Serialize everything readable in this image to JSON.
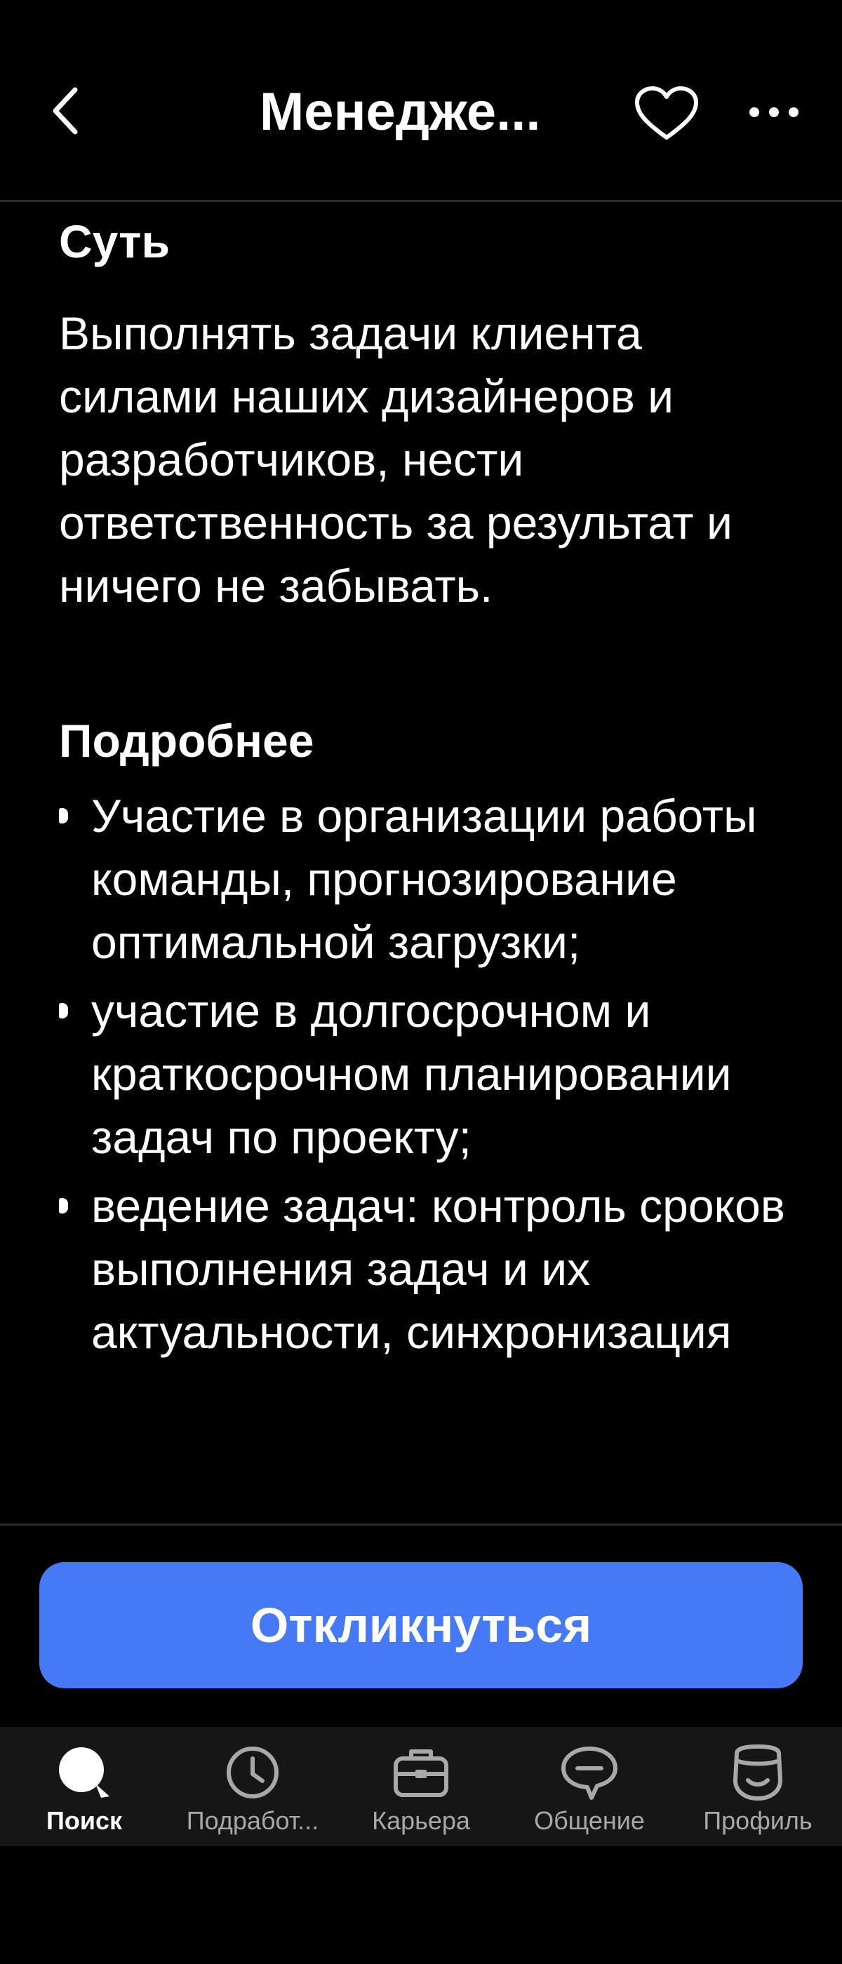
{
  "header": {
    "title": "Менедже..."
  },
  "content": {
    "section1_heading": "Суть",
    "section1_text": "Выполнять задачи клиента силами наших дизайнеров и разработчиков, нести ответственность за результат и ничего не забывать.",
    "section2_heading": "Подробнее",
    "bullets": [
      "Участие в организации работы команды, прогнозирование оптимальной загрузки;",
      "участие в долгосрочном и краткосрочном планировании задач по проекту;",
      "ведение задач: контроль сроков выполнения задач и их актуальности, синхронизация"
    ]
  },
  "cta": {
    "label": "Откликнуться",
    "color": "#4579f5"
  },
  "tabbar": {
    "tabs": [
      {
        "label": "Поиск",
        "icon": "search-icon",
        "active": true
      },
      {
        "label": "Подработ...",
        "icon": "clock-icon",
        "active": false
      },
      {
        "label": "Карьера",
        "icon": "briefcase-icon",
        "active": false
      },
      {
        "label": "Общение",
        "icon": "chat-icon",
        "active": false
      },
      {
        "label": "Профиль",
        "icon": "profile-icon",
        "active": false
      }
    ]
  }
}
